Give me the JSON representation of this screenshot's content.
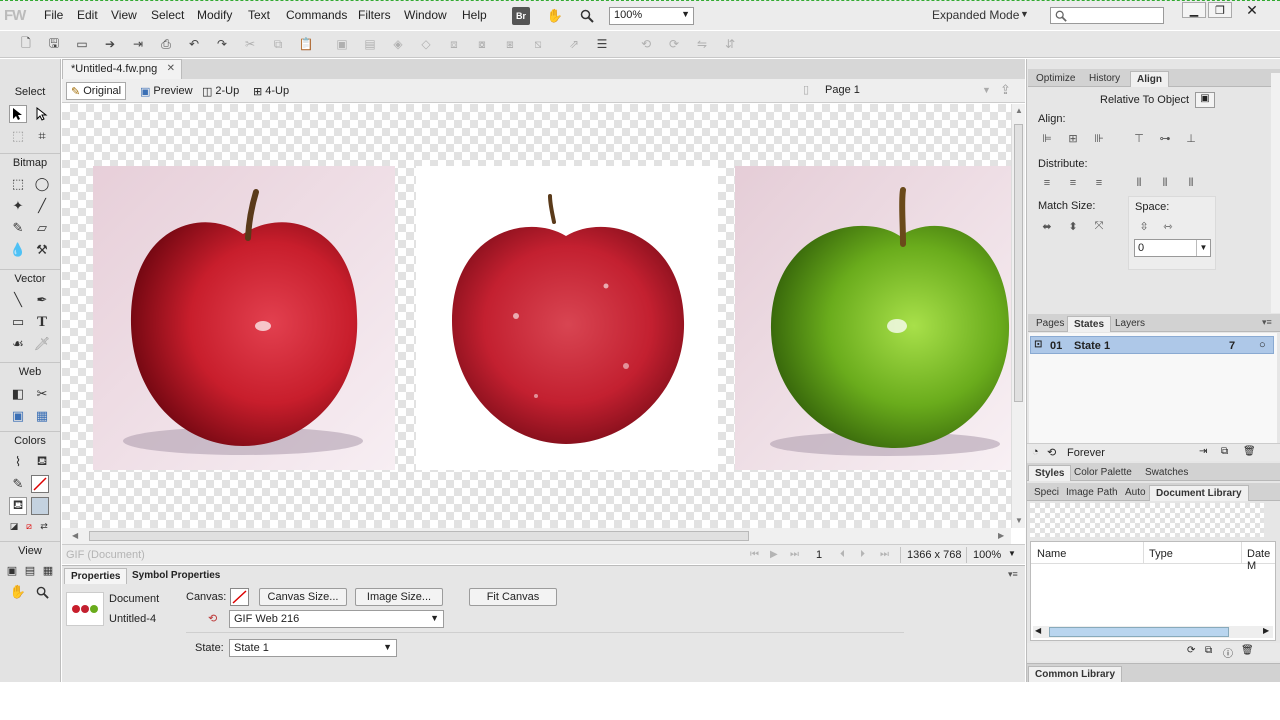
{
  "app": {
    "logo": "FW"
  },
  "menu": [
    "File",
    "Edit",
    "View",
    "Select",
    "Modify",
    "Text",
    "Commands",
    "Filters",
    "Window",
    "Help"
  ],
  "topbar": {
    "bridge_label": "Br",
    "zoom": "100%",
    "workspace": "Expanded Mode"
  },
  "document": {
    "tab_label": "*Untitled-4.fw.png",
    "views": [
      "Original",
      "Preview",
      "2-Up",
      "4-Up"
    ],
    "page_label": "Page 1"
  },
  "tools": {
    "sections": [
      "Select",
      "Bitmap",
      "Vector",
      "Web",
      "Colors",
      "View"
    ]
  },
  "status": {
    "format": "GIF (Document)",
    "frame": "1",
    "dimensions": "1366 x 768",
    "zoom": "100%"
  },
  "properties": {
    "tabs": [
      "Properties",
      "Symbol Properties"
    ],
    "doc_label": "Document",
    "doc_name": "Untitled-4",
    "canvas_label": "Canvas:",
    "canvas_size_btn": "Canvas Size...",
    "image_size_btn": "Image Size...",
    "fit_canvas_btn": "Fit Canvas",
    "palette": "GIF Web 216",
    "state_label": "State:",
    "state_value": "State 1"
  },
  "align_panel": {
    "tabs": [
      "Optimize",
      "History",
      "Align"
    ],
    "relative_to": "Relative To Object",
    "align_label": "Align:",
    "distribute_label": "Distribute:",
    "match_size_label": "Match Size:",
    "space_label": "Space:",
    "space_value": "0"
  },
  "states_panel": {
    "tabs": [
      "Pages",
      "States",
      "Layers"
    ],
    "rows": [
      {
        "num": "01",
        "name": "State 1",
        "delay": "7"
      }
    ],
    "loop": "Forever"
  },
  "styles_panel": {
    "tabs": [
      "Styles",
      "Color Palette",
      "Swatches"
    ]
  },
  "library_panel": {
    "tabs": [
      "Speci",
      "Image",
      "Path",
      "Auto",
      "Document Library"
    ],
    "columns": [
      "Name",
      "Type",
      "Date M"
    ]
  },
  "common_library": {
    "tab": "Common Library"
  },
  "colors": {
    "accent_select": "#aec8e8",
    "apple_red": "#c81e2c",
    "apple_green": "#6aac1c"
  }
}
